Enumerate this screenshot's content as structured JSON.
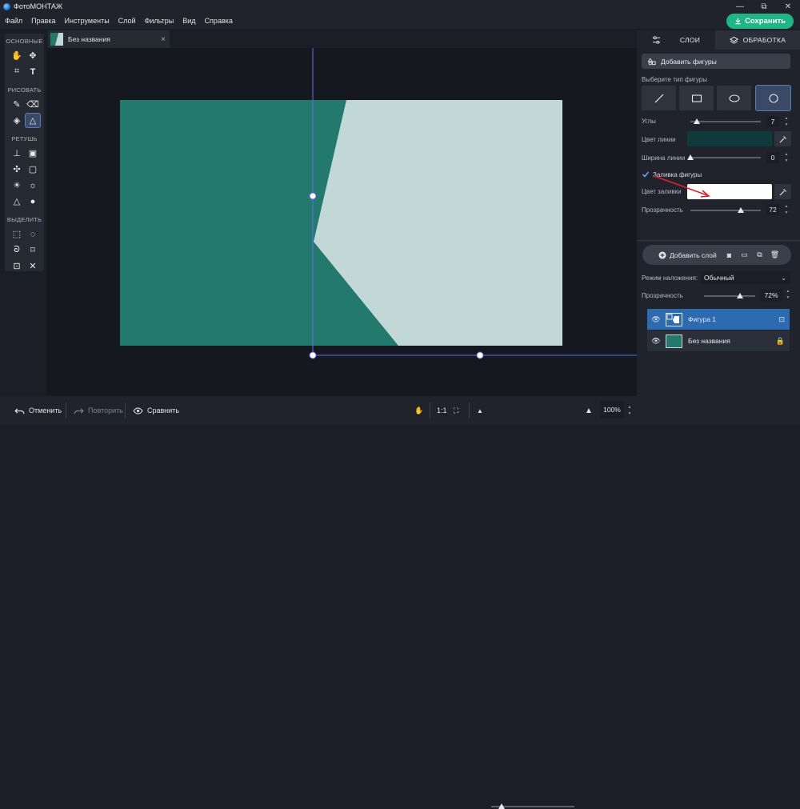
{
  "titlebar": {
    "app_title": "ФотоМОНТАЖ",
    "minimize": "—",
    "maximize": "⧉",
    "close": "✕"
  },
  "menu": [
    "Файл",
    "Правка",
    "Инструменты",
    "Слой",
    "Фильтры",
    "Вид",
    "Справка"
  ],
  "save_button": "Сохранить",
  "tools": {
    "basic_label": "ОСНОВНЫЕ",
    "draw_label": "РИСОВАТЬ",
    "retouch_label": "РЕТУШЬ",
    "select_label": "ВЫДЕЛИТЬ"
  },
  "document_tab": {
    "name": "Без названия",
    "close": "×"
  },
  "canvas": {
    "bg_color": "#23796e",
    "shape_color": "#c2d8d6",
    "guide_color": "#6a6cf0"
  },
  "bottombar": {
    "undo": "Отменить",
    "redo": "Повторить",
    "compare": "Сравнить",
    "ratio": "1:1",
    "zoom": "100%",
    "zoom_level": 0.05
  },
  "right_tabs": {
    "layers": "СЛОИ",
    "processing": "ОБРАБОТКА"
  },
  "shapes_panel": {
    "add_shapes": "Добавить фигуры",
    "choose_type": "Выберите тип фигуры",
    "types": [
      "line",
      "rectangle",
      "ellipse",
      "polygon"
    ],
    "selected_type": "polygon",
    "corners_label": "Углы",
    "corners_value": "7",
    "line_color_label": "Цвет линии",
    "line_color": "#0f3a3c",
    "line_width_label": "Ширина линии",
    "line_width_value": "0",
    "fill_label": "Заливка фигуры",
    "fill_checked": true,
    "fill_color_label": "Цвет заливки",
    "fill_color": "#ffffff",
    "opacity_label": "Прозрачность",
    "opacity_value": "72"
  },
  "layers_panel": {
    "add_layer": "Добавить слой",
    "blend_label": "Режим наложения:",
    "blend_value": "Обычный",
    "opacity_label": "Прозрачность",
    "opacity_value": "72%",
    "layers": [
      {
        "name": "Фигура 1",
        "selected": true,
        "locked": false
      },
      {
        "name": "Без названия",
        "selected": false,
        "locked": true
      }
    ]
  }
}
